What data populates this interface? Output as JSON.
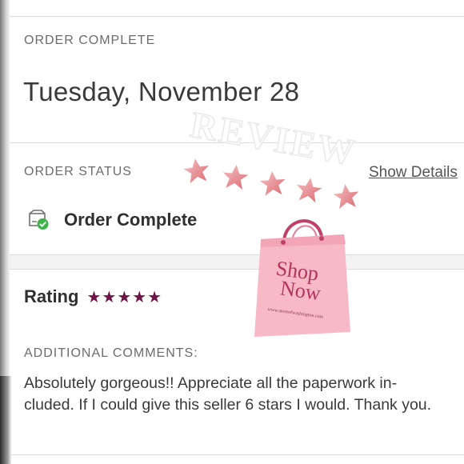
{
  "order": {
    "complete_label": "ORDER COMPLETE",
    "date": "Tuesday, November 28",
    "status_label": "ORDER STATUS",
    "show_details": "Show Details",
    "status_text": "Order Complete"
  },
  "rating": {
    "label": "Rating",
    "stars": "★★★★★",
    "value": 5,
    "max": 5
  },
  "comments": {
    "label": "ADDITIONAL COMMENTS:",
    "text": "Absolutely gorgeous!! Appreciate all the paperwork in-cluded. If I could give this seller 6 stars I would. Thank you."
  },
  "overlay": {
    "review_text": "REVIEW",
    "bag_text_line1": "Shop",
    "bag_text_line2": "Now",
    "bag_small_text": "www.storeofwashington.com",
    "sticker_stars": 5
  },
  "colors": {
    "rating_star": "#6e1446",
    "check_green": "#3db34a",
    "bag_pink": "#f6b9c5",
    "bag_text": "#b0345f",
    "sticker_star": "#e9868c"
  }
}
